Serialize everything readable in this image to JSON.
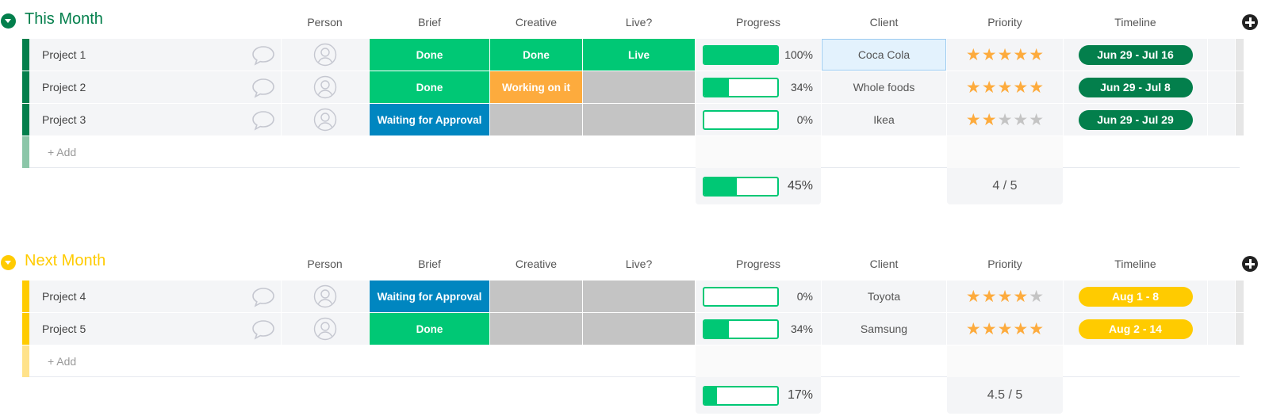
{
  "columns": {
    "person": "Person",
    "brief": "Brief",
    "creative": "Creative",
    "live": "Live?",
    "progress": "Progress",
    "client": "Client",
    "priority": "Priority",
    "timeline": "Timeline"
  },
  "colors": {
    "done": "#00c875",
    "working": "#fdab3d",
    "waiting": "#0086c0",
    "empty": "#c4c4c4",
    "star_on": "#fdab3d",
    "star_off": "#c4c4c4",
    "group1": "#037f4c",
    "group1_light": "#8bc6a8",
    "group2": "#ffcb00",
    "group2_light": "#ffe28a"
  },
  "groups": [
    {
      "title": "This Month",
      "add_label": "+ Add",
      "summary": {
        "progress_pct": 45,
        "progress_label": "45%",
        "priority_label": "4 / 5"
      },
      "rows": [
        {
          "name": "Project 1",
          "brief": "Done",
          "brief_state": "done",
          "creative": "Done",
          "creative_state": "done",
          "live": "Live",
          "live_state": "done",
          "progress_pct": 100,
          "progress_label": "100%",
          "client": "Coca Cola",
          "priority": 5,
          "timeline": "Jun 29 - Jul 16"
        },
        {
          "name": "Project 2",
          "brief": "Done",
          "brief_state": "done",
          "creative": "Working on it",
          "creative_state": "working",
          "live": "",
          "live_state": "empty",
          "progress_pct": 34,
          "progress_label": "34%",
          "client": "Whole foods",
          "priority": 5,
          "timeline": "Jun 29 - Jul 8"
        },
        {
          "name": "Project 3",
          "brief": "Waiting for Approval",
          "brief_state": "waiting",
          "creative": "",
          "creative_state": "empty",
          "live": "",
          "live_state": "empty",
          "progress_pct": 0,
          "progress_label": "0%",
          "client": "Ikea",
          "priority": 2,
          "timeline": "Jun 29 - Jul 29"
        }
      ]
    },
    {
      "title": "Next Month",
      "add_label": "+ Add",
      "summary": {
        "progress_pct": 17,
        "progress_label": "17%",
        "priority_label": "4.5 / 5"
      },
      "rows": [
        {
          "name": "Project 4",
          "brief": "Waiting for Approval",
          "brief_state": "waiting",
          "creative": "",
          "creative_state": "empty",
          "live": "",
          "live_state": "empty",
          "progress_pct": 0,
          "progress_label": "0%",
          "client": "Toyota",
          "priority": 4,
          "timeline": "Aug 1 - 8"
        },
        {
          "name": "Project 5",
          "brief": "Done",
          "brief_state": "done",
          "creative": "",
          "creative_state": "empty",
          "live": "",
          "live_state": "empty",
          "progress_pct": 34,
          "progress_label": "34%",
          "client": "Samsung",
          "priority": 5,
          "timeline": "Aug 2 - 14"
        }
      ]
    }
  ]
}
